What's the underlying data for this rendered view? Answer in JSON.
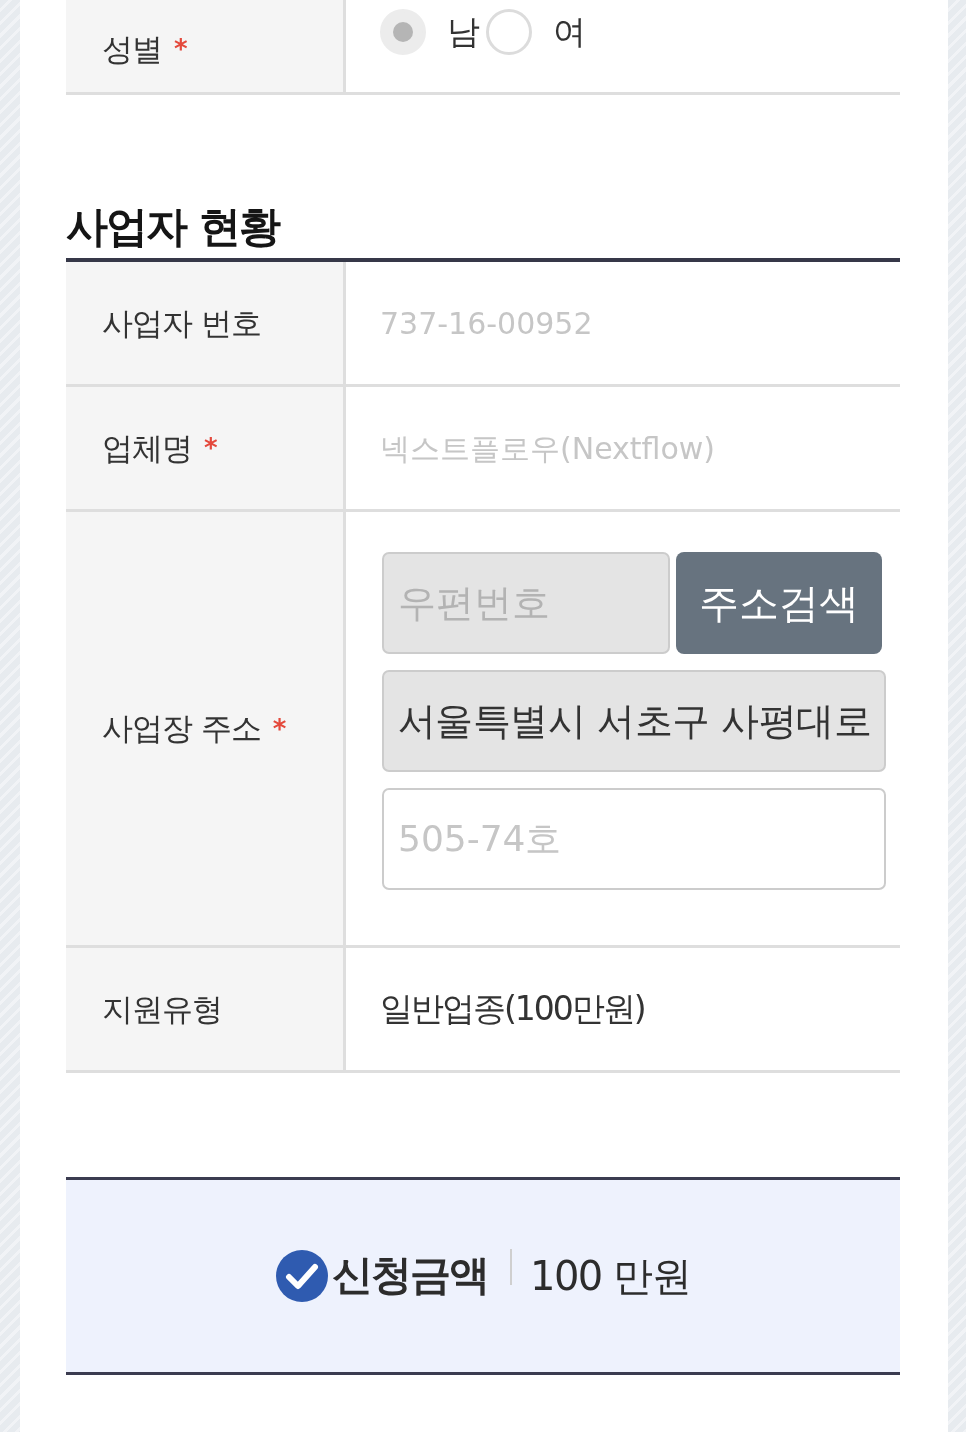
{
  "personal_form": {
    "rows": [
      {
        "kind": "radio",
        "label": "성별",
        "required_mark": "*",
        "options": [
          {
            "label": "남",
            "selected": true
          },
          {
            "label": "여",
            "selected": false
          }
        ]
      }
    ]
  },
  "business_section": {
    "title": "사업자 현황",
    "rows": [
      {
        "kind": "text",
        "label": "사업자 번호",
        "value": "737-16-00952",
        "faded": true
      },
      {
        "kind": "text",
        "label": "업체명",
        "required_mark": "*",
        "value": "넥스트플로우(Nextflow)",
        "faded": true
      },
      {
        "kind": "address",
        "label": "사업장 주소",
        "required_mark": "*",
        "postcode": {
          "placeholder": "우편번호",
          "readonly": true
        },
        "search_button": "주소검색",
        "address": {
          "value": "서울특별시 서초구 사평대로",
          "readonly": true
        },
        "detail": {
          "value": "505-74호",
          "readonly": false,
          "faded": true
        }
      },
      {
        "kind": "text",
        "label": "지원유형",
        "value": "일반업종(100만원)",
        "faded": false
      }
    ]
  },
  "summary": {
    "label": "신청금액",
    "amount": "100 만원"
  }
}
